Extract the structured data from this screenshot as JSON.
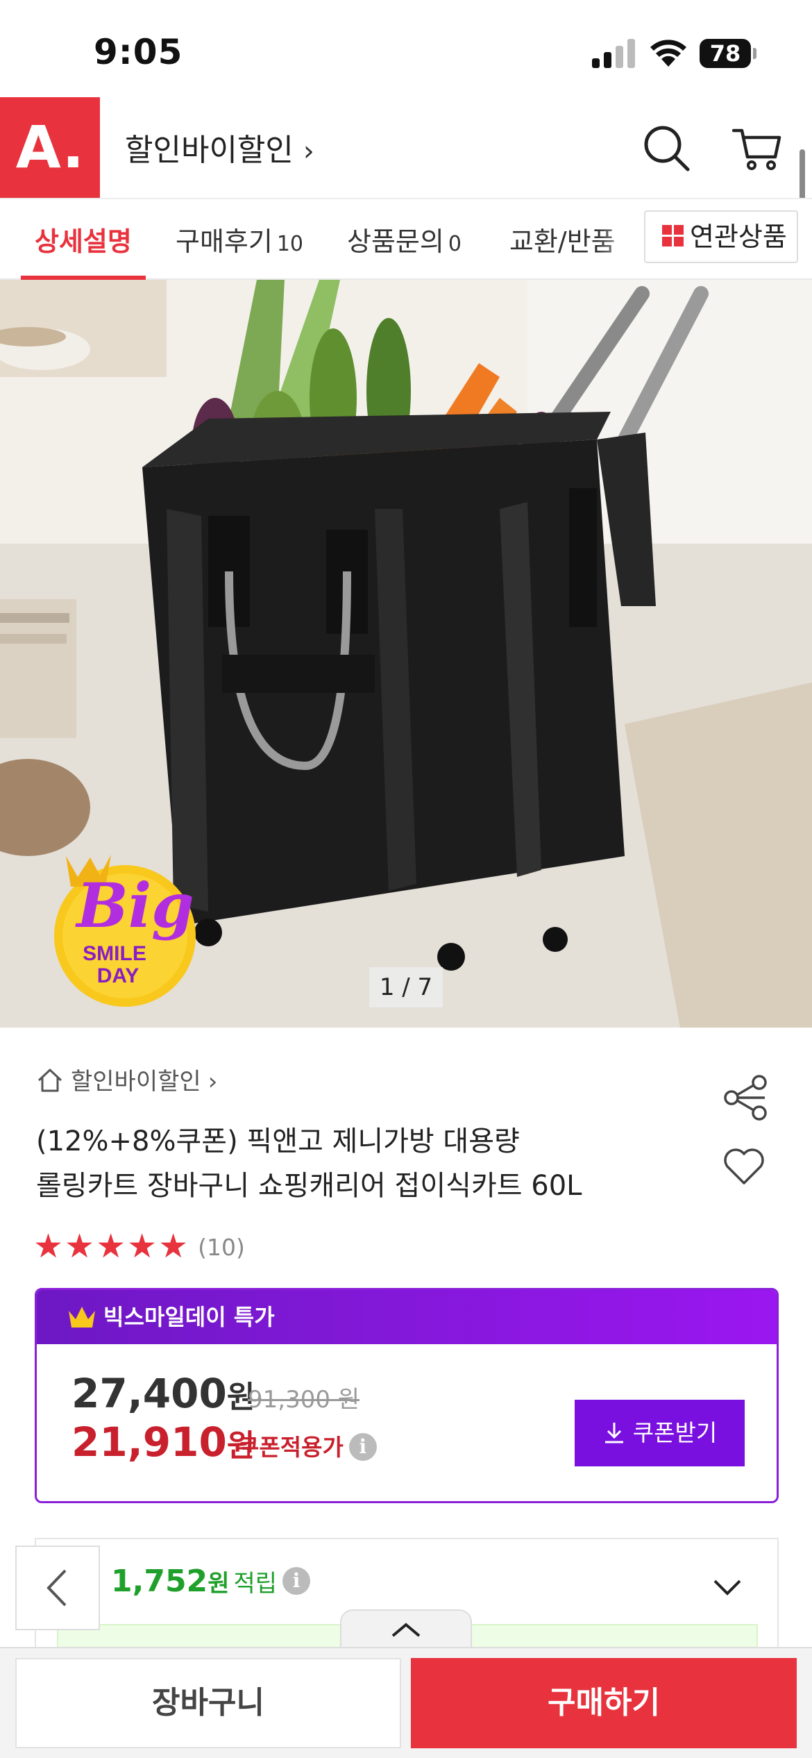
{
  "status_bar": {
    "time": "9:05",
    "battery": "78"
  },
  "header": {
    "logo_text": "A.",
    "store_name": "할인바이할인",
    "chevron": "›",
    "icons": [
      "search-icon",
      "cart-icon"
    ]
  },
  "tabs": [
    {
      "label": "상세설명",
      "count": ""
    },
    {
      "label": "구매후기",
      "count": "10"
    },
    {
      "label": "상품문의",
      "count": "0"
    },
    {
      "label": "교환/반품",
      "count": ""
    }
  ],
  "related_tab": {
    "label": "연관상품"
  },
  "hero": {
    "counter": "1 / 7",
    "badge_line1": "Big",
    "badge_line2": "SMILE",
    "badge_line3": "DAY"
  },
  "product": {
    "breadcrumb": "할인바이할인",
    "title_line1": "(12%+8%쿠폰) 픽앤고 제니가방 대용량",
    "title_line2": "롤링카트 장바구니 쇼핑캐리어 접이식카트 60L",
    "rating": 5,
    "review_count": "(10)"
  },
  "promo": {
    "header": "빅스마일데이 특가",
    "price": "27,400",
    "price_unit": "원",
    "original_price": "91,300 원",
    "coupon_price": "21,910",
    "coupon_unit": "원",
    "coupon_note": "쿠폰적용가",
    "info": "i",
    "coupon_button": "쿠폰받기"
  },
  "points": {
    "amount": "1,752",
    "unit": "원",
    "label": "적립",
    "info": "i"
  },
  "bottom": {
    "cart_button": "장바구니",
    "buy_button": "구매하기"
  },
  "colors": {
    "brand_red": "#e8323d",
    "promo_purple": "#7a10e0",
    "points_green": "#1fa02a"
  }
}
